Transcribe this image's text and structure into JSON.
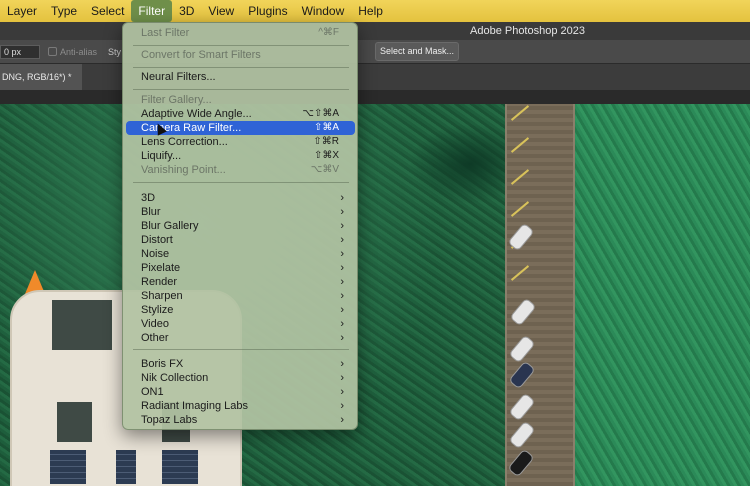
{
  "menubar": {
    "items": [
      "Layer",
      "Type",
      "Select",
      "Filter",
      "3D",
      "View",
      "Plugins",
      "Window",
      "Help"
    ],
    "active": "Filter"
  },
  "titlebar": {
    "title": "Adobe Photoshop 2023"
  },
  "options_bar": {
    "feather_value": "0 px",
    "antialias_label": "Anti-alias",
    "style_label": "Sty",
    "select_mask_label": "Select and Mask..."
  },
  "document_tab": {
    "label": "DNG, RGB/16*) *"
  },
  "filter_menu": {
    "last_filter": {
      "label": "Last Filter",
      "shortcut": "^⌘F",
      "enabled": false
    },
    "convert_smart": {
      "label": "Convert for Smart Filters",
      "enabled": false
    },
    "neural_filters": {
      "label": "Neural Filters...",
      "enabled": true
    },
    "filter_gallery": {
      "label": "Filter Gallery...",
      "enabled": false
    },
    "adaptive_wide_angle": {
      "label": "Adaptive Wide Angle...",
      "shortcut": "⌥⇧⌘A",
      "enabled": true
    },
    "camera_raw": {
      "label": "Camera Raw Filter...",
      "shortcut": "⇧⌘A",
      "enabled": true,
      "highlighted": true
    },
    "lens_correction": {
      "label": "Lens Correction...",
      "shortcut": "⇧⌘R",
      "enabled": true
    },
    "liquify": {
      "label": "Liquify...",
      "shortcut": "⇧⌘X",
      "enabled": true
    },
    "vanishing_point": {
      "label": "Vanishing Point...",
      "shortcut": "⌥⌘V",
      "enabled": false
    },
    "submenus": [
      "3D",
      "Blur",
      "Blur Gallery",
      "Distort",
      "Noise",
      "Pixelate",
      "Render",
      "Sharpen",
      "Stylize",
      "Video",
      "Other"
    ],
    "plugins": [
      "Boris FX",
      "Nik Collection",
      "ON1",
      "Radiant Imaging Labs",
      "Topaz Labs"
    ],
    "submenu_chevron": "›"
  }
}
